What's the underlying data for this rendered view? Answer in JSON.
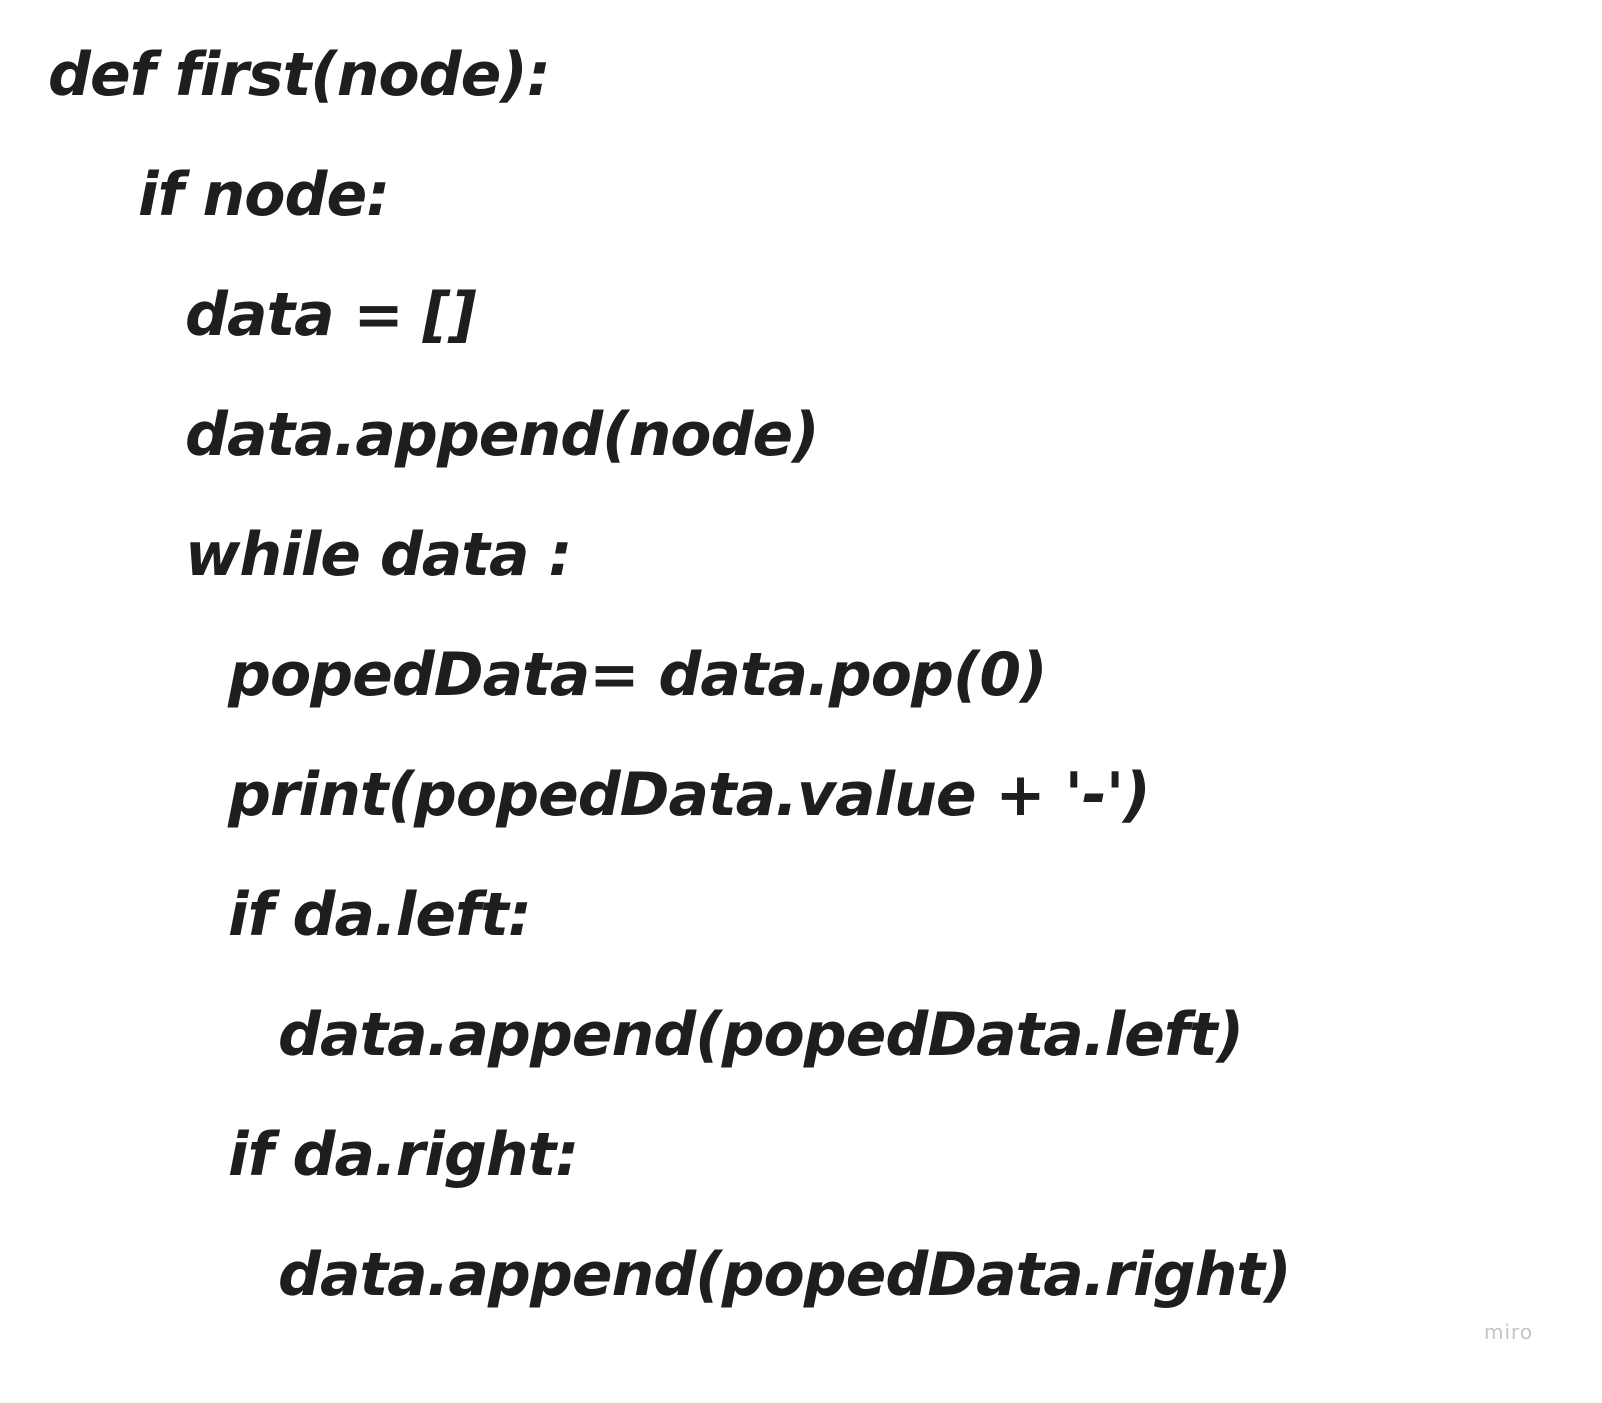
{
  "code_lines": [
    "def first(node):",
    "if node:",
    "data = []",
    "data.append(node)",
    "while data :",
    "popedData= data.pop(0)",
    "print(popedData.value + '-')",
    "if da.left:",
    "data.append(popedData.left)",
    "if da.right:",
    "data.append(popedData.right)"
  ],
  "watermark": "miro"
}
